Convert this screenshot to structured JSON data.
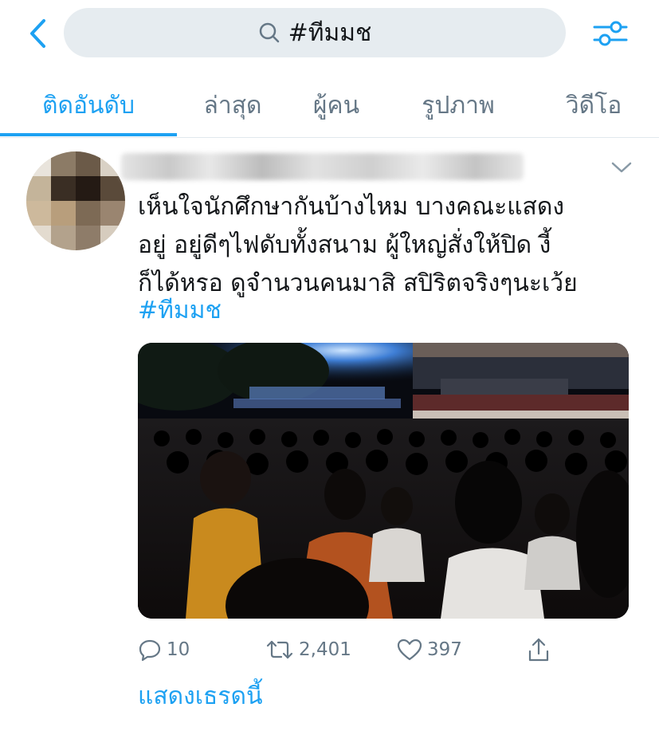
{
  "search": {
    "query": "#ทีมมช"
  },
  "tabs": [
    {
      "label": "ติดอันดับ",
      "active": true
    },
    {
      "label": "ล่าสุด",
      "active": false
    },
    {
      "label": "ผู้คน",
      "active": false
    },
    {
      "label": "รูปภาพ",
      "active": false
    },
    {
      "label": "วิดีโอ",
      "active": false
    }
  ],
  "tweet": {
    "text_lines": [
      "เห็นใจนักศึกษากันบ้างไหม  บางคณะแสดง",
      "อยู่ อยู่ดีๆไฟดับทั้งสนาม ผู้ใหญ่สั่งให้ปิด งี้",
      "ก็ได้หรอ ดูจำนวนคนมาสิ สปิริตจริงๆนะเว้ย"
    ],
    "hashtag": "#ทีมมช",
    "actions": {
      "replies": "10",
      "retweets": "2,401",
      "likes": "397"
    },
    "show_thread": "แสดงเธรดนี้"
  },
  "colors": {
    "accent": "#1da1f2",
    "muted": "#657786",
    "text": "#14171a",
    "search_bg": "#e6ecf0"
  },
  "icons": [
    "back-chevron-icon",
    "search-icon",
    "filter-settings-icon",
    "caret-down-icon",
    "reply-icon",
    "retweet-icon",
    "like-icon",
    "share-icon"
  ]
}
